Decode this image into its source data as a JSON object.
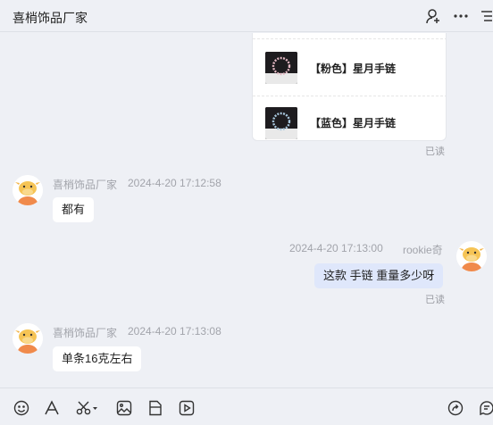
{
  "header": {
    "title": "喜梢饰品厂家"
  },
  "products": [
    {
      "label": "【粉色】星月手链"
    },
    {
      "label": "【蓝色】星月手链"
    }
  ],
  "read_status": "已读",
  "messages": [
    {
      "sender": "喜梢饰品厂家",
      "time": "2024-4-20 17:12:58",
      "text": "都有"
    },
    {
      "sender": "rookie奇",
      "time": "2024-4-20 17:13:00",
      "text": "这款 手链 重量多少呀",
      "read": "已读"
    },
    {
      "sender": "喜梢饰品厂家",
      "time": "2024-4-20 17:13:08",
      "text": "单条16克左右"
    }
  ],
  "icons": {
    "header": [
      "user-add-icon",
      "more-icon",
      "list-icon"
    ],
    "toolbar": [
      "emoji-icon",
      "font-icon",
      "scissors-icon",
      "image-icon",
      "file-icon",
      "video-icon",
      "share-icon",
      "quick-reply-icon"
    ]
  }
}
